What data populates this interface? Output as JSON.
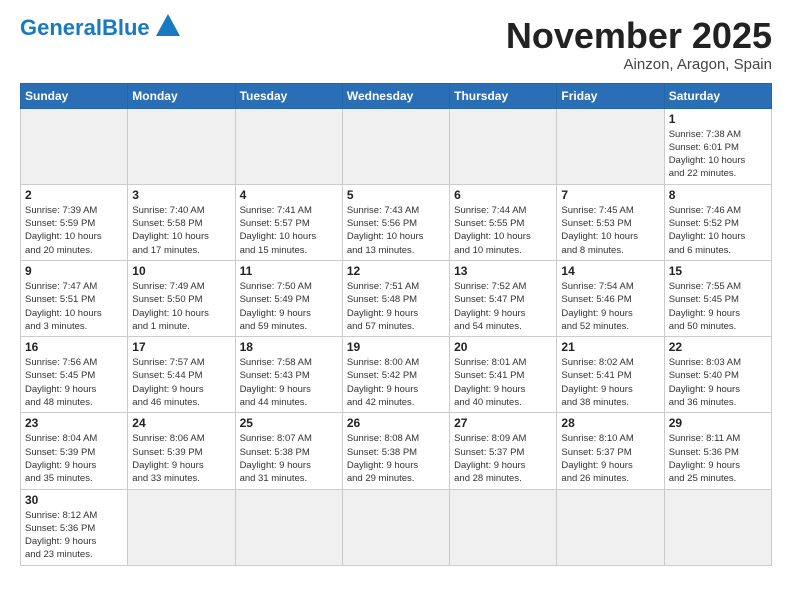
{
  "header": {
    "logo_general": "General",
    "logo_blue": "Blue",
    "month_title": "November 2025",
    "location": "Ainzon, Aragon, Spain"
  },
  "weekdays": [
    "Sunday",
    "Monday",
    "Tuesday",
    "Wednesday",
    "Thursday",
    "Friday",
    "Saturday"
  ],
  "weeks": [
    [
      {
        "day": "",
        "info": ""
      },
      {
        "day": "",
        "info": ""
      },
      {
        "day": "",
        "info": ""
      },
      {
        "day": "",
        "info": ""
      },
      {
        "day": "",
        "info": ""
      },
      {
        "day": "",
        "info": ""
      },
      {
        "day": "1",
        "info": "Sunrise: 7:38 AM\nSunset: 6:01 PM\nDaylight: 10 hours\nand 22 minutes."
      }
    ],
    [
      {
        "day": "2",
        "info": "Sunrise: 7:39 AM\nSunset: 5:59 PM\nDaylight: 10 hours\nand 20 minutes."
      },
      {
        "day": "3",
        "info": "Sunrise: 7:40 AM\nSunset: 5:58 PM\nDaylight: 10 hours\nand 17 minutes."
      },
      {
        "day": "4",
        "info": "Sunrise: 7:41 AM\nSunset: 5:57 PM\nDaylight: 10 hours\nand 15 minutes."
      },
      {
        "day": "5",
        "info": "Sunrise: 7:43 AM\nSunset: 5:56 PM\nDaylight: 10 hours\nand 13 minutes."
      },
      {
        "day": "6",
        "info": "Sunrise: 7:44 AM\nSunset: 5:55 PM\nDaylight: 10 hours\nand 10 minutes."
      },
      {
        "day": "7",
        "info": "Sunrise: 7:45 AM\nSunset: 5:53 PM\nDaylight: 10 hours\nand 8 minutes."
      },
      {
        "day": "8",
        "info": "Sunrise: 7:46 AM\nSunset: 5:52 PM\nDaylight: 10 hours\nand 6 minutes."
      }
    ],
    [
      {
        "day": "9",
        "info": "Sunrise: 7:47 AM\nSunset: 5:51 PM\nDaylight: 10 hours\nand 3 minutes."
      },
      {
        "day": "10",
        "info": "Sunrise: 7:49 AM\nSunset: 5:50 PM\nDaylight: 10 hours\nand 1 minute."
      },
      {
        "day": "11",
        "info": "Sunrise: 7:50 AM\nSunset: 5:49 PM\nDaylight: 9 hours\nand 59 minutes."
      },
      {
        "day": "12",
        "info": "Sunrise: 7:51 AM\nSunset: 5:48 PM\nDaylight: 9 hours\nand 57 minutes."
      },
      {
        "day": "13",
        "info": "Sunrise: 7:52 AM\nSunset: 5:47 PM\nDaylight: 9 hours\nand 54 minutes."
      },
      {
        "day": "14",
        "info": "Sunrise: 7:54 AM\nSunset: 5:46 PM\nDaylight: 9 hours\nand 52 minutes."
      },
      {
        "day": "15",
        "info": "Sunrise: 7:55 AM\nSunset: 5:45 PM\nDaylight: 9 hours\nand 50 minutes."
      }
    ],
    [
      {
        "day": "16",
        "info": "Sunrise: 7:56 AM\nSunset: 5:45 PM\nDaylight: 9 hours\nand 48 minutes."
      },
      {
        "day": "17",
        "info": "Sunrise: 7:57 AM\nSunset: 5:44 PM\nDaylight: 9 hours\nand 46 minutes."
      },
      {
        "day": "18",
        "info": "Sunrise: 7:58 AM\nSunset: 5:43 PM\nDaylight: 9 hours\nand 44 minutes."
      },
      {
        "day": "19",
        "info": "Sunrise: 8:00 AM\nSunset: 5:42 PM\nDaylight: 9 hours\nand 42 minutes."
      },
      {
        "day": "20",
        "info": "Sunrise: 8:01 AM\nSunset: 5:41 PM\nDaylight: 9 hours\nand 40 minutes."
      },
      {
        "day": "21",
        "info": "Sunrise: 8:02 AM\nSunset: 5:41 PM\nDaylight: 9 hours\nand 38 minutes."
      },
      {
        "day": "22",
        "info": "Sunrise: 8:03 AM\nSunset: 5:40 PM\nDaylight: 9 hours\nand 36 minutes."
      }
    ],
    [
      {
        "day": "23",
        "info": "Sunrise: 8:04 AM\nSunset: 5:39 PM\nDaylight: 9 hours\nand 35 minutes."
      },
      {
        "day": "24",
        "info": "Sunrise: 8:06 AM\nSunset: 5:39 PM\nDaylight: 9 hours\nand 33 minutes."
      },
      {
        "day": "25",
        "info": "Sunrise: 8:07 AM\nSunset: 5:38 PM\nDaylight: 9 hours\nand 31 minutes."
      },
      {
        "day": "26",
        "info": "Sunrise: 8:08 AM\nSunset: 5:38 PM\nDaylight: 9 hours\nand 29 minutes."
      },
      {
        "day": "27",
        "info": "Sunrise: 8:09 AM\nSunset: 5:37 PM\nDaylight: 9 hours\nand 28 minutes."
      },
      {
        "day": "28",
        "info": "Sunrise: 8:10 AM\nSunset: 5:37 PM\nDaylight: 9 hours\nand 26 minutes."
      },
      {
        "day": "29",
        "info": "Sunrise: 8:11 AM\nSunset: 5:36 PM\nDaylight: 9 hours\nand 25 minutes."
      }
    ],
    [
      {
        "day": "30",
        "info": "Sunrise: 8:12 AM\nSunset: 5:36 PM\nDaylight: 9 hours\nand 23 minutes."
      },
      {
        "day": "",
        "info": ""
      },
      {
        "day": "",
        "info": ""
      },
      {
        "day": "",
        "info": ""
      },
      {
        "day": "",
        "info": ""
      },
      {
        "day": "",
        "info": ""
      },
      {
        "day": "",
        "info": ""
      }
    ]
  ]
}
